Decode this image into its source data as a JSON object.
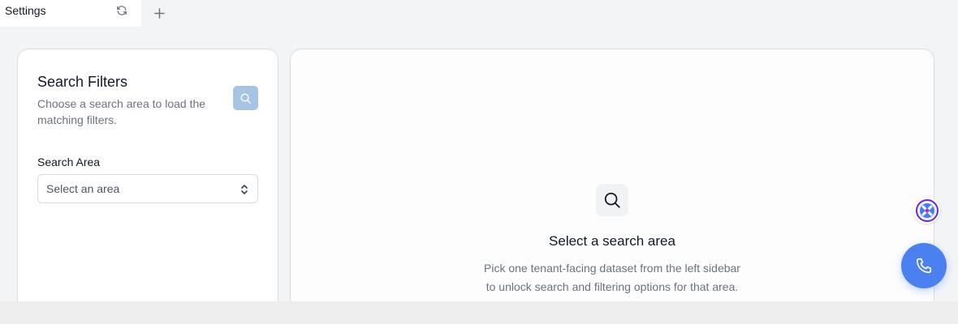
{
  "tabs": {
    "active_label": "Settings",
    "refresh_icon": "refresh-icon",
    "add_icon": "plus-icon"
  },
  "sidebar": {
    "title": "Search Filters",
    "subtitle": "Choose a search area to load the matching filters.",
    "search_button_icon": "search-icon",
    "field_label": "Search Area",
    "select_placeholder": "Select an area",
    "select_icon": "chevron-up-down-icon"
  },
  "main": {
    "empty_icon": "search-icon",
    "empty_title": "Select a search area",
    "empty_description_line1": "Pick one tenant-facing dataset from the left sidebar",
    "empty_description_line2": "to unlock search and filtering options for that area."
  },
  "floating": {
    "assistant_icon": "assistant-badge-icon",
    "call_icon": "phone-icon"
  },
  "colors": {
    "accent": "#4a80f0",
    "search_button": "#a7c4e4",
    "border": "#d9dce1",
    "muted_text": "#6b7280"
  }
}
